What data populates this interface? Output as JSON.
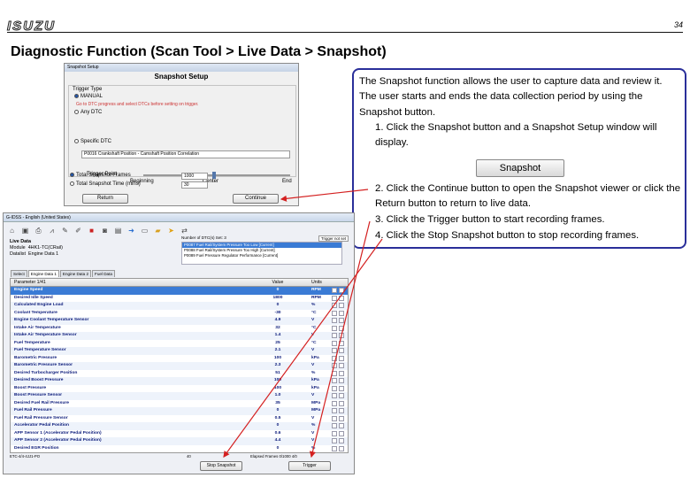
{
  "header": {
    "logo": "ISUZU",
    "page_number": "34"
  },
  "title": "Diagnostic Function (Scan Tool > Live Data > Snapshot)",
  "snapshot_setup": {
    "window_title": "Snapshot Setup",
    "heading": "Snapshot Setup",
    "trigger_type_label": "Trigger Type",
    "manual_label": "MANUAL",
    "manual_note": "Go to DTC progress and select DTCs before setting on trigger.",
    "any_dtc_label": "Any DTC",
    "specific_dtc_label": "Specific DTC",
    "specific_dtc_value": "P0016 Crankshaft Position - Camshaft Position Correlation",
    "trigger_point_label": "Trigger Point",
    "trigger_points": [
      "Beginning",
      "Center",
      "End"
    ],
    "total_frames_label": "Total Snapshot Frames",
    "total_frames_value": "1000",
    "total_time_label": "Total Snapshot Time (mins)",
    "total_time_value": "30",
    "return_label": "Return",
    "continue_label": "Continue"
  },
  "callout": {
    "intro": "The Snapshot function allows the user to capture data and review it. The user starts and ends the data collection period by using the Snapshot button.",
    "step1": "1. Click the Snapshot button and a Snapshot Setup window will display.",
    "snapshot_button_label": "Snapshot",
    "step2": "2. Click the Continue button to open the Snapshot viewer or click the Return button to return to live data.",
    "step3": "3. Click the Trigger button to start recording frames.",
    "step4": "4. Click the Stop Snapshot button to stop recording frames."
  },
  "live_data": {
    "window_title": "G-IDSS - English (United States)",
    "section": "Live Data",
    "module_label": "Module",
    "module_value": "4HK1-TC(CRail)",
    "datalist_label": "Datalist",
    "datalist_value": "Engine Data 1",
    "dtc_count": "Number of DTC(s) Set: 3",
    "dtc_list": [
      "P0087 Fuel Rail/System Pressure Too Low [Current]",
      "P0088 Fuel Rail/System Pressure Too High [Current]",
      "P0089 Fuel Pressure Regulator Performance [Current]"
    ],
    "trigger_status": "Trigger not set",
    "tabs": [
      "Select",
      "Engine Data 1",
      "Engine Data 2",
      "Fuel Data"
    ],
    "col_parameter": "Parameter 1/41",
    "col_value": "Value",
    "col_units": "Units",
    "rows": [
      {
        "p": "Engine Speed",
        "v": "0",
        "u": "RPM"
      },
      {
        "p": "Desired Idle Speed",
        "v": "1800",
        "u": "RPM"
      },
      {
        "p": "Calculated Engine Load",
        "v": "0",
        "u": "%"
      },
      {
        "p": "Coolant Temperature",
        "v": "-30",
        "u": "°C"
      },
      {
        "p": "Engine Coolant Temperature Sensor",
        "v": "4.9",
        "u": "V"
      },
      {
        "p": "Intake Air Temperature",
        "v": "32",
        "u": "°C"
      },
      {
        "p": "Intake Air Temperature Sensor",
        "v": "1.4",
        "u": "V"
      },
      {
        "p": "Fuel Temperature",
        "v": "25",
        "u": "°C"
      },
      {
        "p": "Fuel Temperature Sensor",
        "v": "2.1",
        "u": "V"
      },
      {
        "p": "Barometric Pressure",
        "v": "100",
        "u": "kPa"
      },
      {
        "p": "Barometric Pressure Sensor",
        "v": "2.3",
        "u": "V"
      },
      {
        "p": "Desired Turbocharger Position",
        "v": "51",
        "u": "%"
      },
      {
        "p": "Desired Boost Pressure",
        "v": "100",
        "u": "kPa"
      },
      {
        "p": "Boost Pressure",
        "v": "100",
        "u": "kPa"
      },
      {
        "p": "Boost Pressure Sensor",
        "v": "1.0",
        "u": "V"
      },
      {
        "p": "Desired Fuel Rail Pressure",
        "v": "35",
        "u": "MPa"
      },
      {
        "p": "Fuel Rail Pressure",
        "v": "0",
        "u": "MPa"
      },
      {
        "p": "Fuel Rail Pressure Sensor",
        "v": "0.5",
        "u": "V"
      },
      {
        "p": "Accelerator Pedal Position",
        "v": "0",
        "u": "%"
      },
      {
        "p": "APP Sensor 1 (Accelerator Pedal Position)",
        "v": "0.6",
        "u": "V"
      },
      {
        "p": "APP Sensor 2 (Accelerator Pedal Position)",
        "v": "4.4",
        "u": "V"
      },
      {
        "p": "Desired EGR Position",
        "v": "0",
        "u": "%"
      }
    ],
    "status_left": "ETC-4/4-4JJ1-PO",
    "status_mid": "40",
    "status_right": "Elapsed Frames 0/1000 4/0",
    "stop_snapshot_label": "Stop Snapshot",
    "trigger_label": "Trigger"
  },
  "colors": {
    "callout_border": "#2a2f9a",
    "arrow": "#d42020",
    "selected_row": "#3a7bd5"
  }
}
